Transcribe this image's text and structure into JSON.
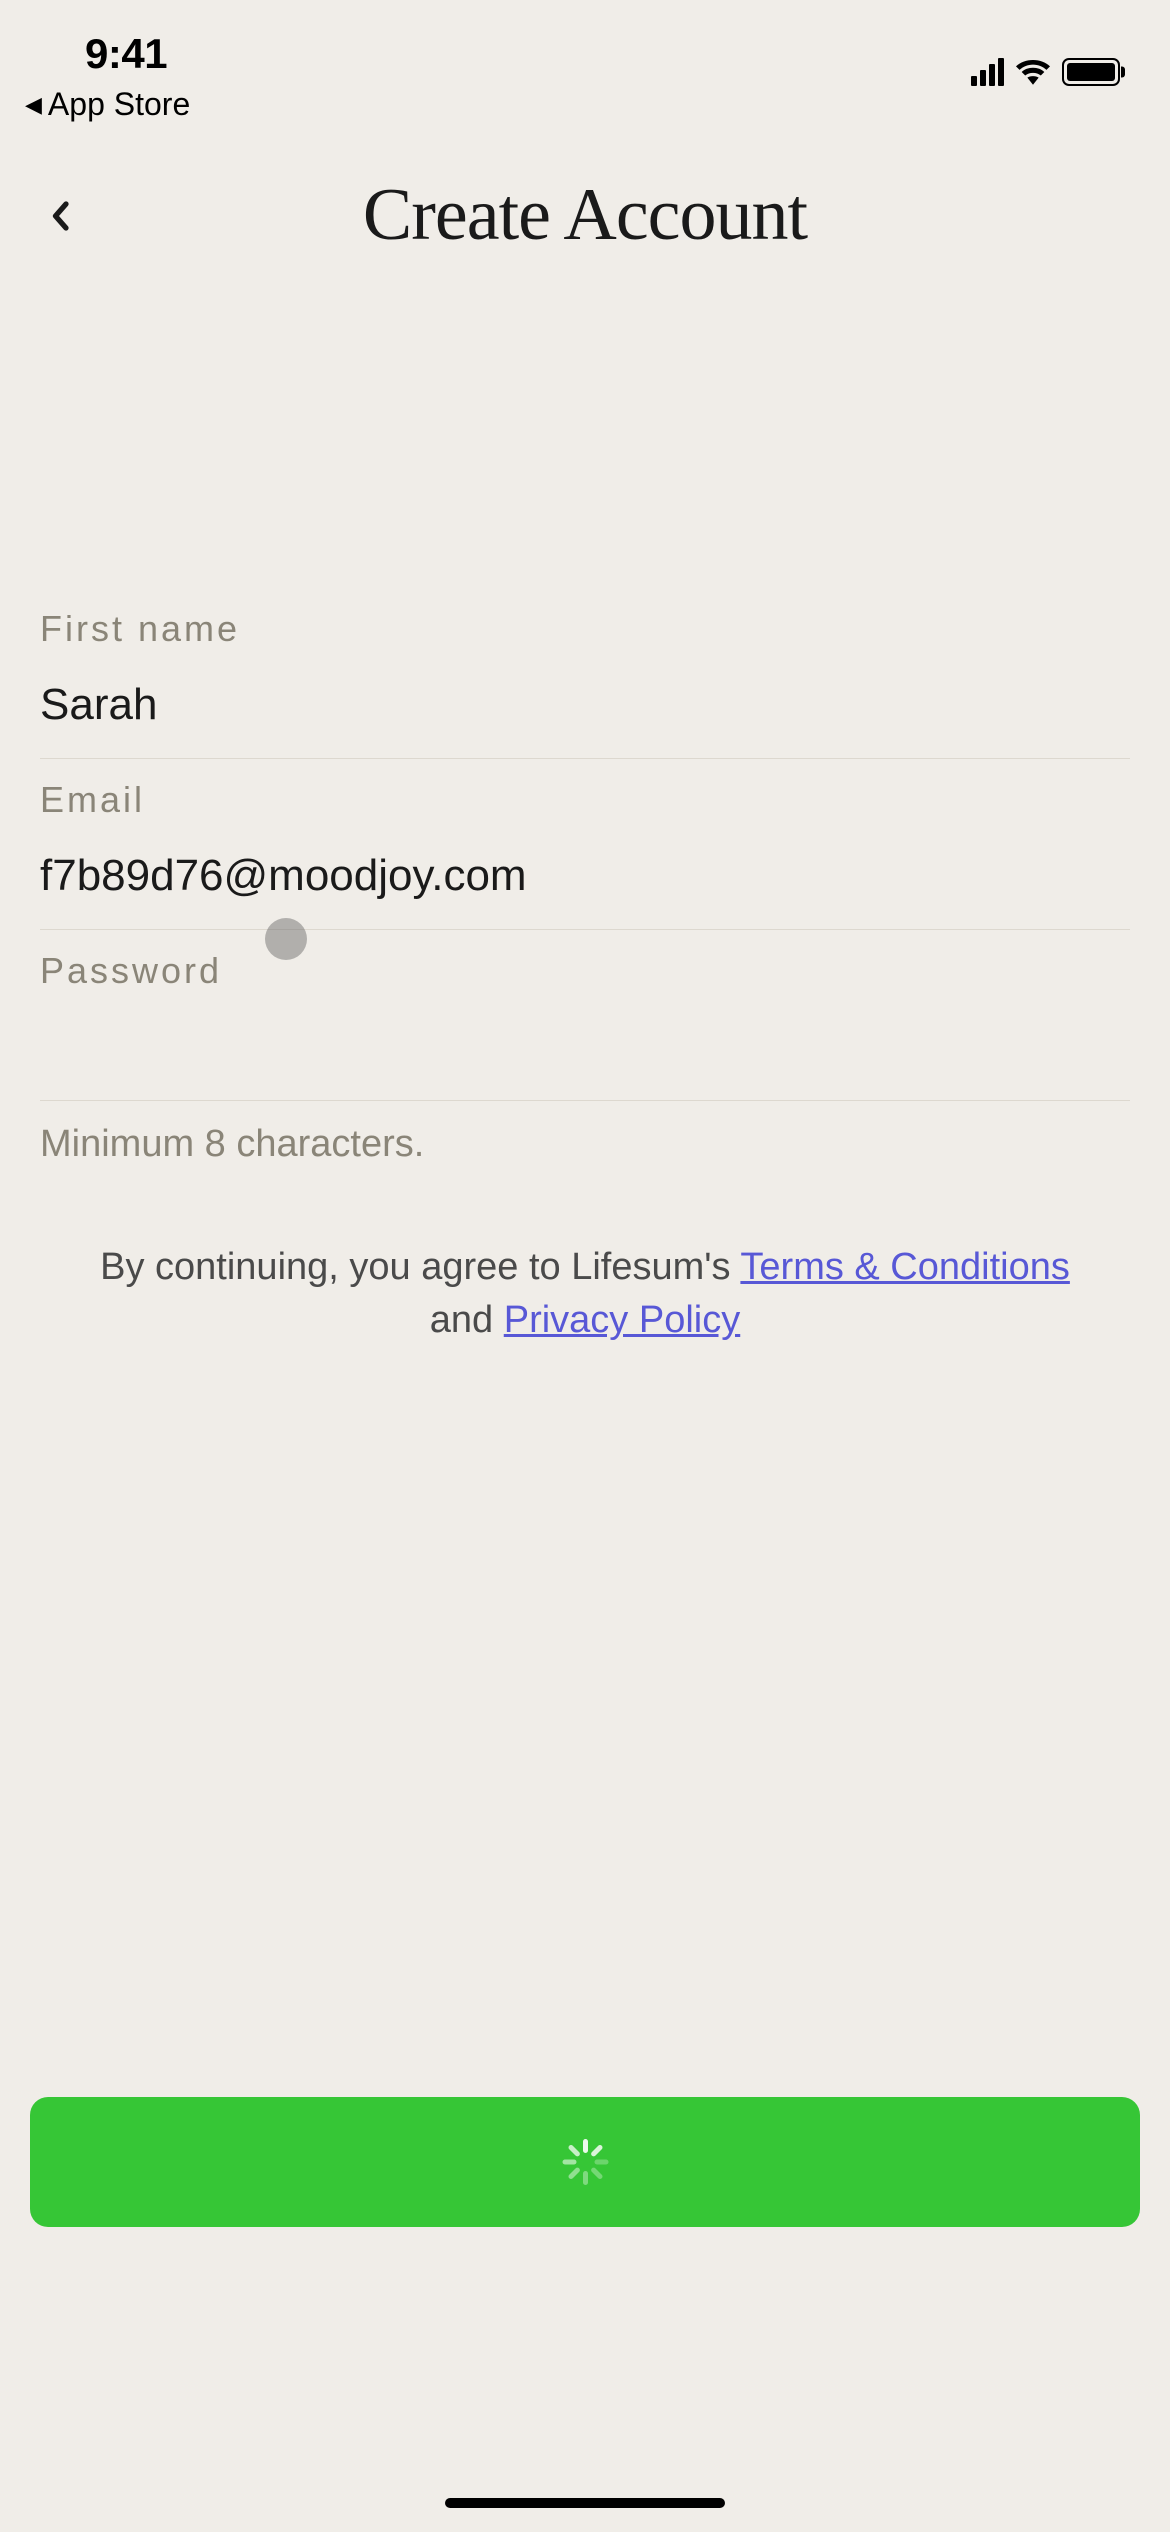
{
  "status_bar": {
    "time": "9:41",
    "app_store_back": "App Store"
  },
  "header": {
    "title": "Create Account"
  },
  "form": {
    "fields": {
      "first_name": {
        "label": "First name",
        "value": "Sarah"
      },
      "email": {
        "label": "Email",
        "value": "f7b89d76@moodjoy.com"
      },
      "password": {
        "label": "Password",
        "value": "",
        "helper": "Minimum 8 characters."
      }
    }
  },
  "legal": {
    "prefix": "By continuing, you agree to Lifesum's ",
    "terms_link": "Terms & Conditions",
    "middle": " and ",
    "privacy_link": "Privacy Policy"
  },
  "colors": {
    "background": "#F0EDE8",
    "button": "#36C636",
    "link": "#5858d6"
  }
}
